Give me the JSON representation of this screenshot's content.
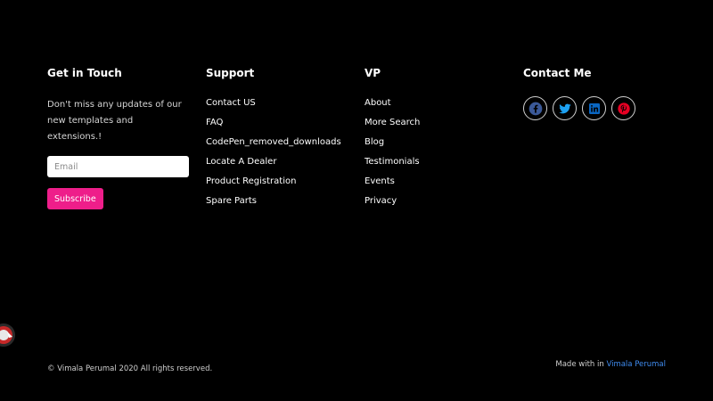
{
  "colors": {
    "background": "#000000",
    "subscribe_button": "#ee1e8a",
    "author_link": "#3f8cf0",
    "facebook": "#3b5998",
    "twitter": "#1da1f2",
    "linkedin": "#0a66c2",
    "pinterest": "#e60023"
  },
  "get_in_touch": {
    "title": "Get in Touch",
    "description": "Don't miss any updates of our new templates and extensions.!",
    "email_placeholder": "Email",
    "subscribe_label": "Subscribe"
  },
  "support": {
    "title": "Support",
    "links": [
      "Contact US",
      "FAQ",
      "CodePen_removed_downloads",
      "Locate A Dealer",
      "Product Registration",
      "Spare Parts"
    ]
  },
  "vp": {
    "title": "VP",
    "links": [
      "About",
      "More Search",
      "Blog",
      "Testimonials",
      "Events",
      "Privacy"
    ]
  },
  "contact_me": {
    "title": "Contact Me",
    "icons": [
      "facebook-icon",
      "twitter-icon",
      "linkedin-icon",
      "pinterest-icon"
    ]
  },
  "footer_bottom": {
    "copyright": "© Vimala Perumal 2020 All rights reserved.",
    "made_with_prefix": "Made with in ",
    "author": "Vimala Perumal"
  }
}
